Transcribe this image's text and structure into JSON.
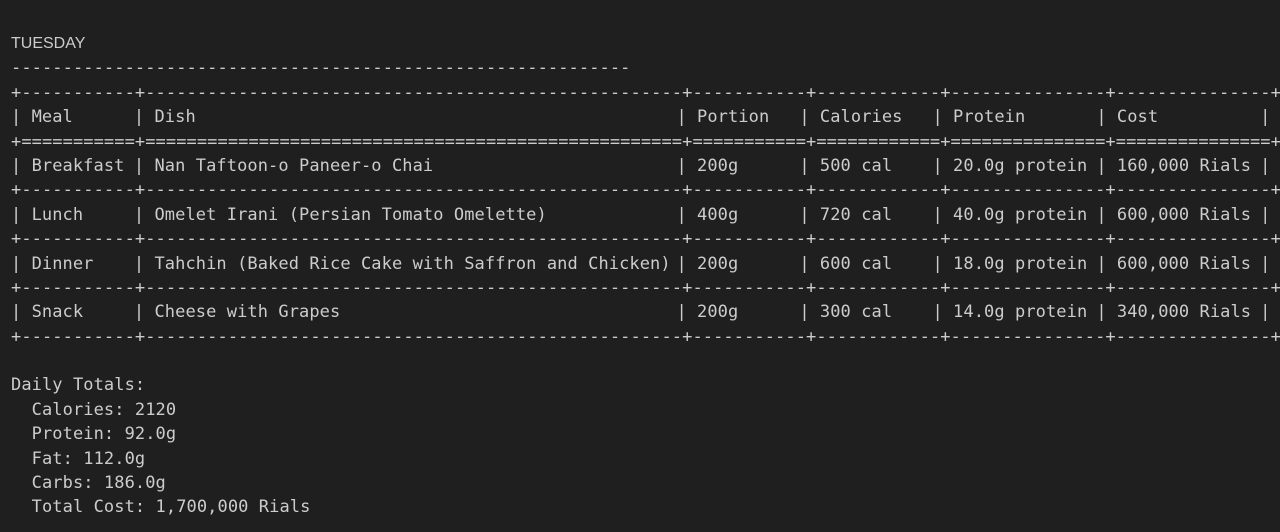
{
  "day_title": "TUESDAY",
  "table": {
    "headers": [
      "Meal",
      "Dish",
      "Portion",
      "Calories",
      "Protein",
      "Cost"
    ],
    "rows": [
      [
        "Breakfast",
        "Nan Taftoon-o Paneer-o Chai",
        "200g",
        "500 cal",
        "20.0g protein",
        "160,000 Rials"
      ],
      [
        "Lunch",
        "Omelet Irani (Persian Tomato Omelette)",
        "400g",
        "720 cal",
        "40.0g protein",
        "600,000 Rials"
      ],
      [
        "Dinner",
        "Tahchin (Baked Rice Cake with Saffron and Chicken)",
        "200g",
        "600 cal",
        "18.0g protein",
        "600,000 Rials"
      ],
      [
        "Snack",
        "Cheese with Grapes",
        "200g",
        "300 cal",
        "14.0g protein",
        "340,000 Rials"
      ]
    ]
  },
  "totals": {
    "heading": "Daily Totals:",
    "calories": "  Calories: 2120",
    "protein": "  Protein: 92.0g",
    "fat": "  Fat: 112.0g",
    "carbs": "  Carbs: 186.0g",
    "cost": "  Total Cost: 1,700,000 Rials"
  }
}
